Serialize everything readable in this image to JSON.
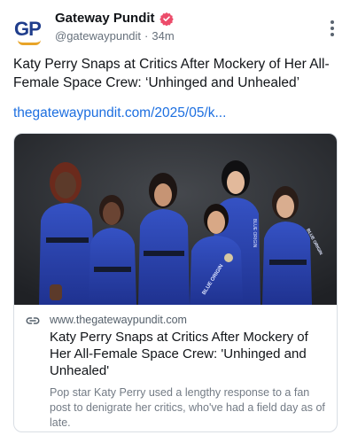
{
  "author": {
    "avatar_text": "GP",
    "display_name": "Gateway Pundit",
    "handle": "@gatewaypundit",
    "separator": "·",
    "time": "34m",
    "verified_color": "#ec4c6a"
  },
  "post": {
    "text": "Katy Perry Snaps at Critics After Mockery of Her All-Female Space Crew: ‘Unhinged and Unhealed’",
    "link": "thegatewaypundit.com/2025/05/k..."
  },
  "card": {
    "image_icon": "group-photo-image",
    "suit_text_1": "BLUE ORIGIN",
    "suit_text_2": "BLUE ORIGIN",
    "suit_text_3": "BLUE ORIGIN",
    "domain": "www.thegatewaypundit.com",
    "title": "Katy Perry Snaps at Critics After Mockery of Her All-Female Space Crew: 'Unhinged and Unhealed'",
    "description": "Pop star Katy Perry used a lengthy response to a fan post to denigrate her critics, who've had a field day as of late."
  },
  "colors": {
    "link": "#1d6fe0",
    "suit_blue": "#2740a8",
    "background_photo": "#2c2f34"
  }
}
